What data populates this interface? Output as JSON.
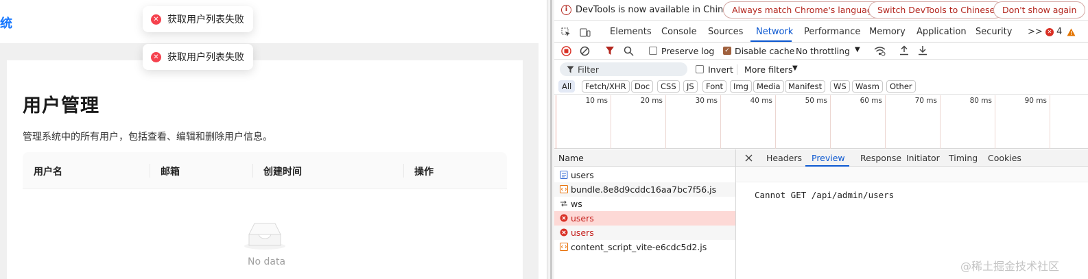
{
  "app": {
    "brand": "统",
    "title": "用户管理",
    "description": "管理系统中的所有用户，包括查看、编辑和删除用户信息。",
    "table": {
      "columns": [
        "用户名",
        "邮箱",
        "创建时间",
        "操作"
      ]
    },
    "empty_text": "No data"
  },
  "toasts": [
    {
      "message": "获取用户列表失败",
      "icon": "error-circle-icon"
    },
    {
      "message": "获取用户列表失败",
      "icon": "error-circle-icon"
    }
  ],
  "devtools": {
    "infobar": {
      "text": "DevTools is now available in Chinese!",
      "buttons": [
        "Always match Chrome's language",
        "Switch DevTools to Chinese",
        "Don't show again"
      ]
    },
    "tabs": [
      "Elements",
      "Console",
      "Sources",
      "Network",
      "Performance",
      "Memory",
      "Application",
      "Security"
    ],
    "active_tab": "Network",
    "more_tabs": ">>",
    "error_count": "4",
    "toolbar": {
      "preserve_log": "Preserve log",
      "disable_cache": "Disable cache",
      "throttling": "No throttling"
    },
    "filter": {
      "placeholder": "Filter",
      "invert": "Invert",
      "more_filters": "More filters"
    },
    "type_filters": [
      "All",
      "Fetch/XHR",
      "Doc",
      "CSS",
      "JS",
      "Font",
      "Img",
      "Media",
      "Manifest",
      "WS",
      "Wasm",
      "Other"
    ],
    "timeline_labels": [
      "10 ms",
      "20 ms",
      "30 ms",
      "40 ms",
      "50 ms",
      "60 ms",
      "70 ms",
      "80 ms",
      "90 ms"
    ],
    "request_list": {
      "header": "Name",
      "rows": [
        {
          "name": "users",
          "type": "doc",
          "status": "ok"
        },
        {
          "name": "bundle.8e8d9cddc16aa7bc7f56.js",
          "type": "script",
          "status": "ok"
        },
        {
          "name": "ws",
          "type": "websocket",
          "status": "ok"
        },
        {
          "name": "users",
          "type": "error",
          "status": "error"
        },
        {
          "name": "users",
          "type": "error",
          "status": "error"
        },
        {
          "name": "content_script_vite-e6cdc5d2.js",
          "type": "script",
          "status": "ok"
        }
      ]
    },
    "detail_tabs": [
      "Headers",
      "Preview",
      "Response",
      "Initiator",
      "Timing",
      "Cookies"
    ],
    "active_detail_tab": "Preview",
    "preview_text": "Cannot GET /api/admin/users"
  },
  "watermark": "@稀土掘金技术社区",
  "colors": {
    "accent": "#0b57d0",
    "error": "#c5221f",
    "brand": "#1677ff"
  }
}
